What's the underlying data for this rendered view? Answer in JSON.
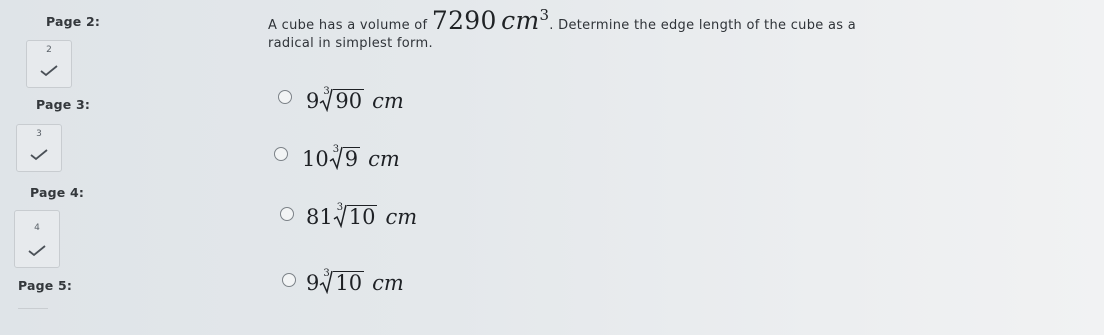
{
  "sidebar": {
    "pages": [
      {
        "label": "Page 2:",
        "number": "2"
      },
      {
        "label": "Page 3:",
        "number": "3"
      },
      {
        "label": "Page 4:",
        "number": "4"
      },
      {
        "label": "Page 5:"
      }
    ]
  },
  "question": {
    "prefix": "A cube has a volume of",
    "volume": "7290",
    "unit": "cm",
    "exponent": "3",
    "suffix": ". Determine the edge length of the cube as a",
    "line2": "radical in simplest form."
  },
  "options": [
    {
      "coefficient": "9",
      "index": "3",
      "radicand": "90",
      "unit": "cm"
    },
    {
      "coefficient": "10",
      "index": "3",
      "radicand": "9",
      "unit": "cm"
    },
    {
      "coefficient": "81",
      "index": "3",
      "radicand": "10",
      "unit": "cm"
    },
    {
      "coefficient": "9",
      "index": "3",
      "radicand": "10",
      "unit": "cm"
    }
  ]
}
